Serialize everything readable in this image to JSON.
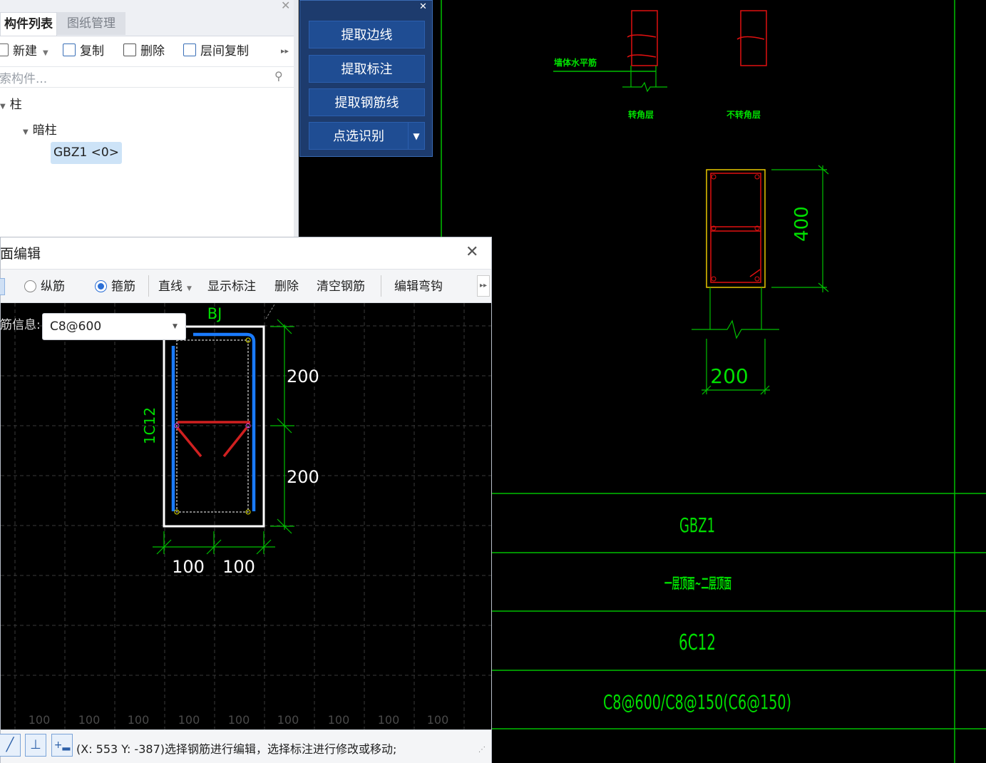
{
  "component_panel": {
    "tabs": [
      "构件列表",
      "图纸管理"
    ],
    "toolbar": {
      "new": "新建",
      "copy": "复制",
      "delete": "删除",
      "floor_copy": "层间复制"
    },
    "search_placeholder": "搜索构件...",
    "tree": {
      "root": "柱",
      "child": "暗柱",
      "selected": "GBZ1 <0>"
    }
  },
  "extract_panel": {
    "buttons": [
      "提取边线",
      "提取标注",
      "提取钢筋线",
      "点选识别"
    ]
  },
  "section_dialog": {
    "title": "截面编辑",
    "toolbar": {
      "longitudinal": "纵筋",
      "stirrup": "箍筋",
      "line_mode": "直线",
      "show_dims": "显示标注",
      "delete": "删除",
      "clear_rebar": "清空钢筋",
      "edit_hook": "编辑弯钩"
    },
    "rebar_info_label": "钢筋信息:",
    "rebar_info_value": "C8@600",
    "canvas": {
      "tag_top": "BJ",
      "tag_left": "1C12",
      "dim_right_1": "200",
      "dim_right_2": "200",
      "dim_bottom_1": "100",
      "dim_bottom_2": "100",
      "ruler": [
        "100",
        "100",
        "100",
        "100",
        "100",
        "100",
        "100",
        "100",
        "100"
      ]
    },
    "status_text": "(X: 553 Y: -387)选择钢筋进行编辑，选择标注进行修改或移动;"
  },
  "cad": {
    "detail_label_1": "墙体水平筋",
    "detail_label_2": "转角层",
    "detail_label_3": "不转角层",
    "section_dim_h": "400",
    "section_dim_w": "200",
    "table": {
      "name": "GBZ1",
      "floors": "一层顶面~二层顶面",
      "longitudinal": "6C12",
      "stirrup": "C8@600/C8@150(C6@150)"
    },
    "colors": {
      "line": "#00ff00",
      "rebar": "#ff2020",
      "column": "#ffd700",
      "background": "#000000"
    }
  }
}
